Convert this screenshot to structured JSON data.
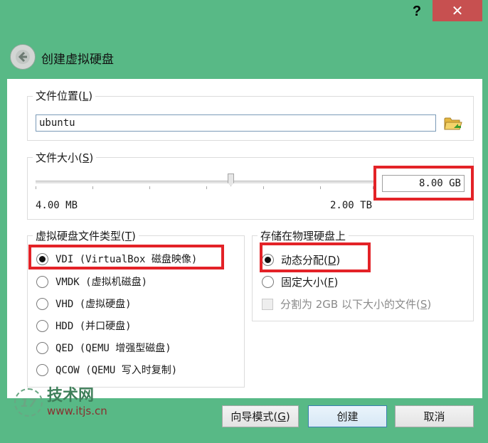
{
  "titlebar": {
    "help_label": "?",
    "close_label": "✕"
  },
  "header": {
    "back_icon": "back-arrow-icon",
    "title": "创建虚拟硬盘"
  },
  "file_location": {
    "group_title": "文件位置(",
    "group_key": "L",
    "group_end": ")",
    "value": "ubuntu",
    "browse_icon": "folder-icon"
  },
  "file_size": {
    "group_title": "文件大小(",
    "group_key": "S",
    "group_end": ")",
    "min_label": "4.00 MB",
    "max_label": "2.00 TB",
    "value": "8.00 GB"
  },
  "disk_type": {
    "group_title": "虚拟硬盘文件类型(",
    "group_key": "T",
    "group_end": ")",
    "options": [
      {
        "label": "VDI (VirtualBox 磁盘映像)",
        "selected": true
      },
      {
        "label": "VMDK (虚拟机磁盘)",
        "selected": false
      },
      {
        "label": "VHD (虚拟硬盘)",
        "selected": false
      },
      {
        "label": "HDD (并口硬盘)",
        "selected": false
      },
      {
        "label": "QED (QEMU 增强型磁盘)",
        "selected": false
      },
      {
        "label": "QCOW (QEMU 写入时复制)",
        "selected": false
      }
    ]
  },
  "storage": {
    "group_title": "存储在物理硬盘上",
    "dynamic_label": "动态分配(",
    "dynamic_key": "D",
    "dynamic_end": ")",
    "fixed_label": "固定大小(",
    "fixed_key": "F",
    "fixed_end": ")",
    "split_label": "分割为 2GB 以下大小的文件(",
    "split_key": "S",
    "split_end": ")"
  },
  "footer": {
    "expert_label": "向导模式(",
    "expert_key": "G",
    "expert_end": ")",
    "create_label": "创建",
    "cancel_label": "取消"
  },
  "watermark": {
    "brand": "技术网",
    "url": "www.itjs.cn",
    "logo_text": "17"
  },
  "colors": {
    "window_bg": "#58b986",
    "close": "#c75050",
    "highlight": "#e32227"
  }
}
